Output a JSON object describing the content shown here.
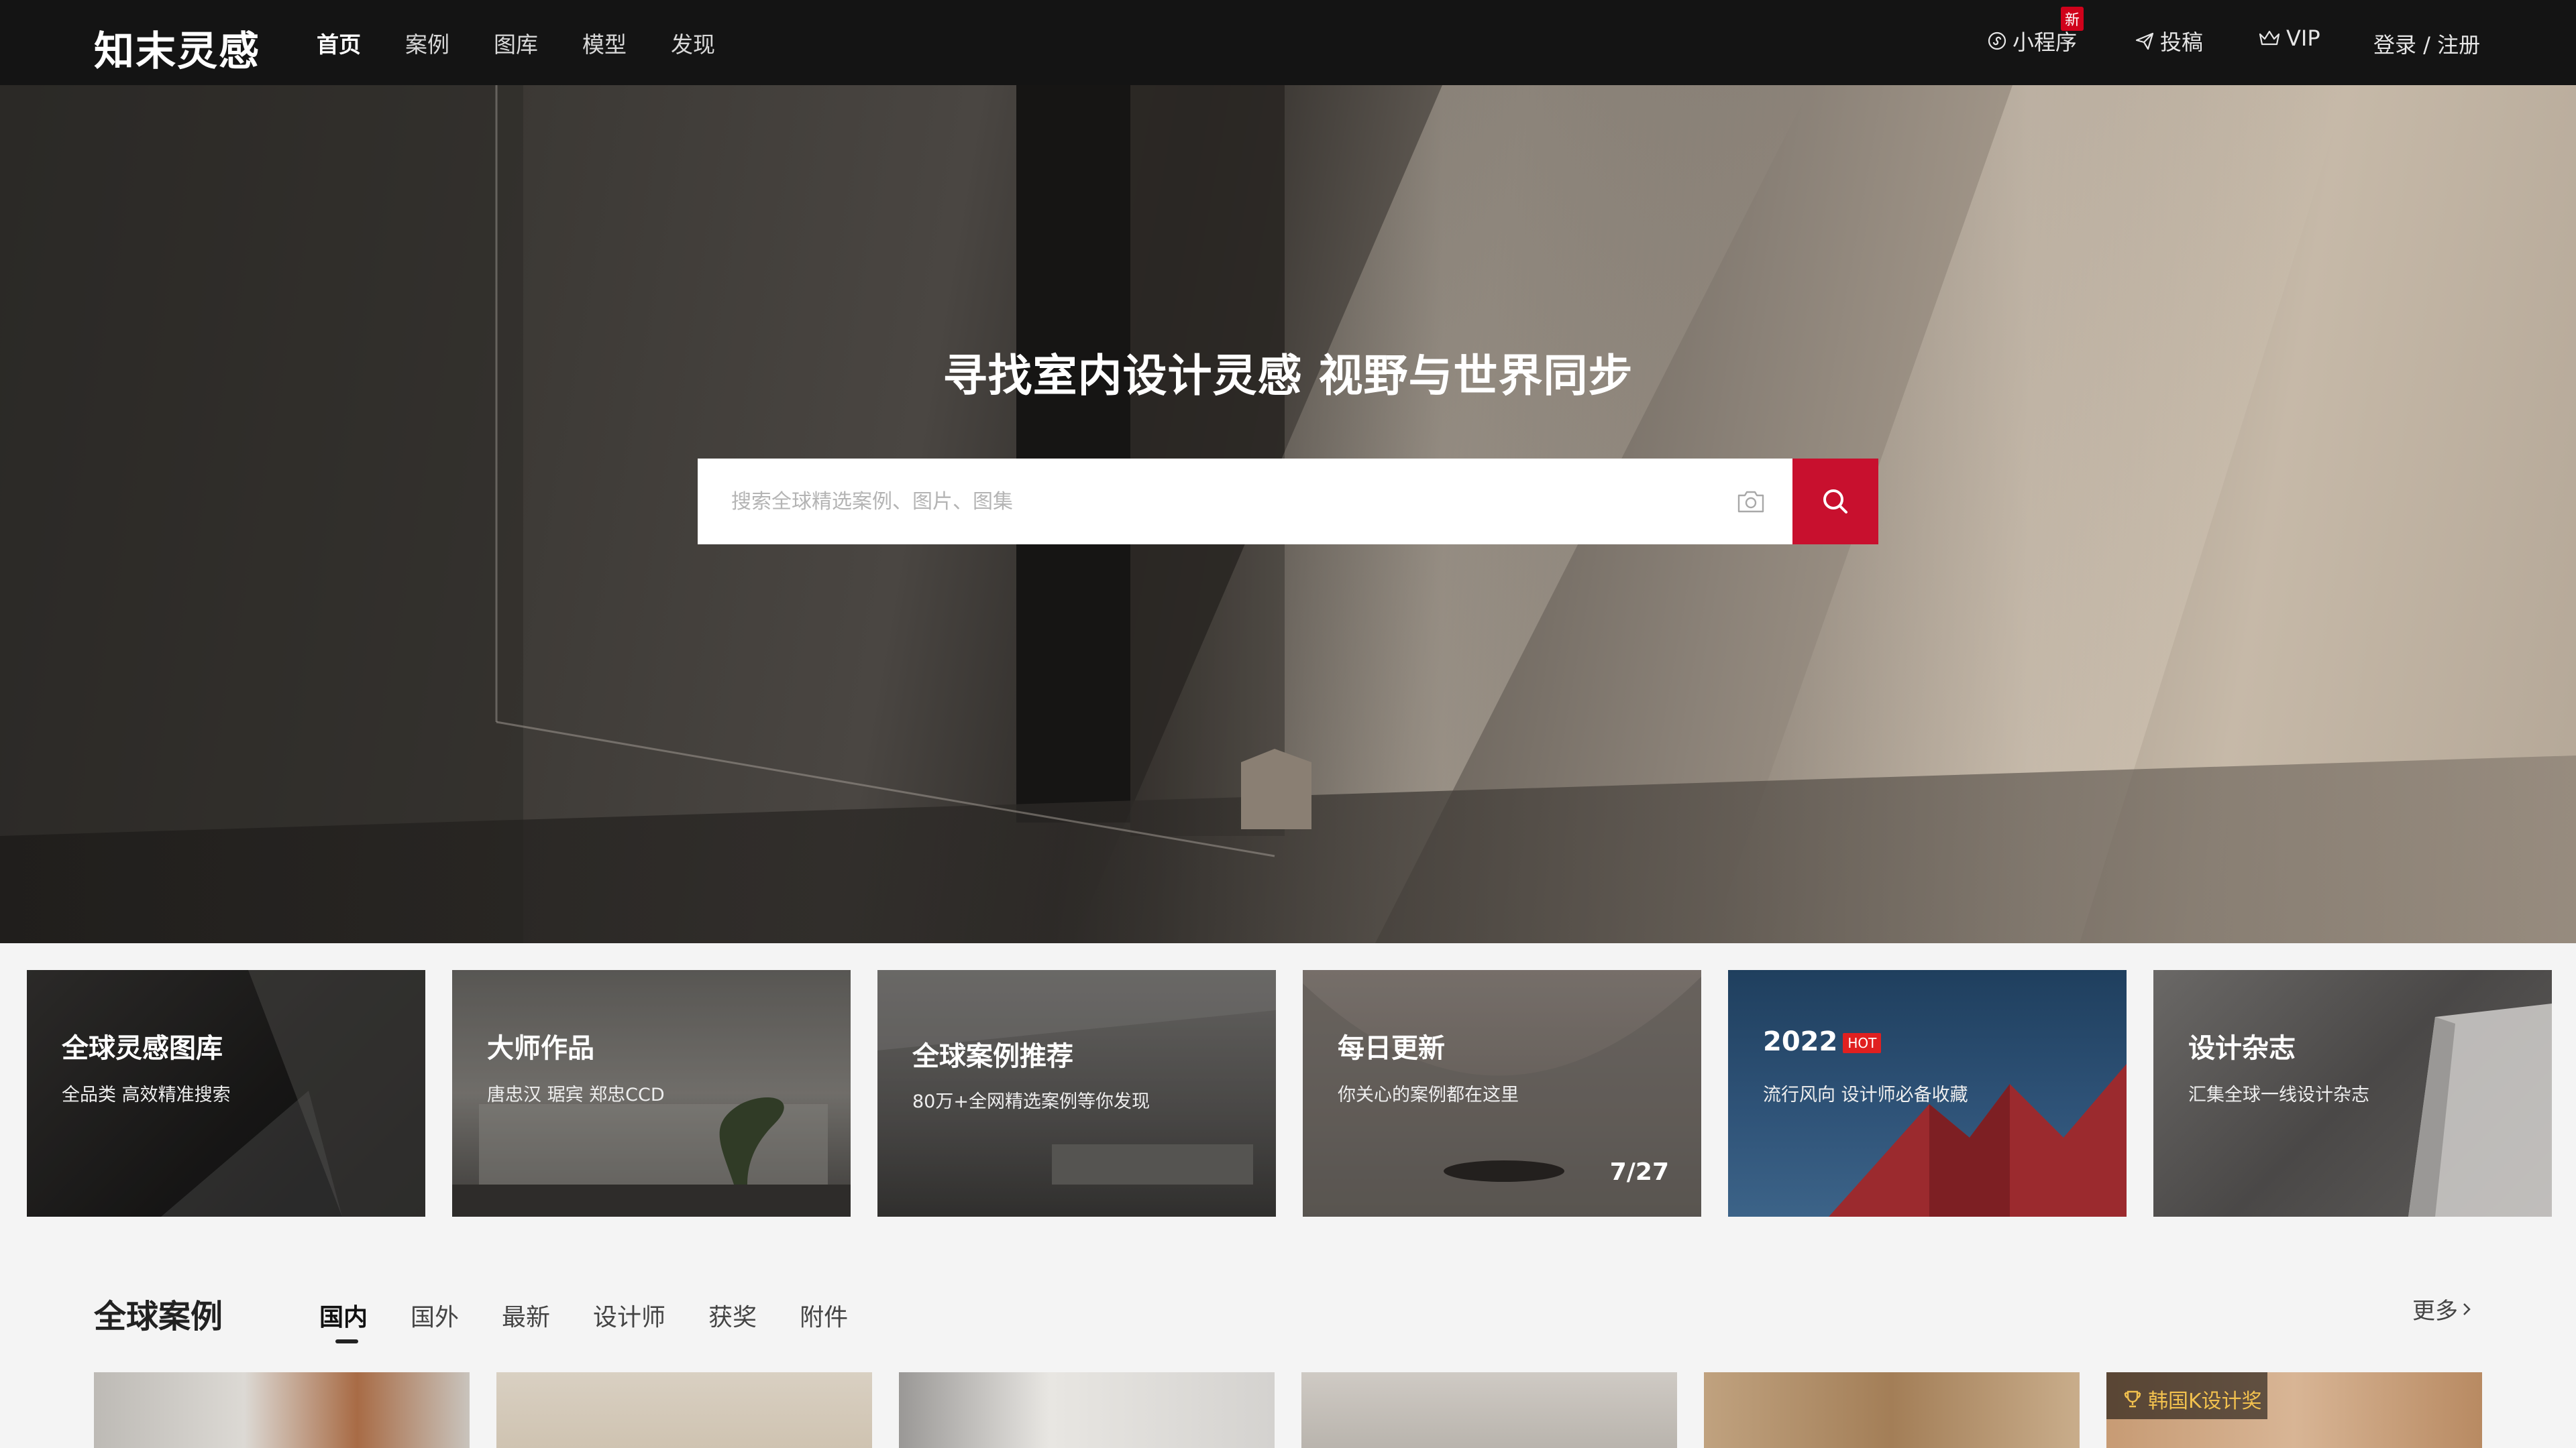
{
  "header": {
    "logo": "知末灵感",
    "nav": [
      {
        "label": "首页",
        "active": true
      },
      {
        "label": "案例",
        "active": false
      },
      {
        "label": "图库",
        "active": false
      },
      {
        "label": "模型",
        "active": false
      },
      {
        "label": "发现",
        "active": false
      }
    ],
    "mini_program": "小程序",
    "new_badge": "新",
    "submit": "投稿",
    "vip": "VIP",
    "login": "登录 / 注册"
  },
  "hero": {
    "title": "寻找室内设计灵感 视野与世界同步",
    "search_placeholder": "搜索全球精选案例、图片、图集",
    "icons": {
      "camera": "camera-icon",
      "search": "search-icon"
    },
    "accent_color": "#c8102e"
  },
  "cards": [
    {
      "title": "全球灵感图库",
      "subtitle": "全品类  高效精准搜索"
    },
    {
      "title": "大师作品",
      "subtitle": "唐忠汉   琚宾   郑忠CCD"
    },
    {
      "title": "全球案例推荐",
      "subtitle": "80万+全网精选案例等你发现"
    },
    {
      "title": "每日更新",
      "subtitle": "你关心的案例都在这里",
      "date": "7/27"
    },
    {
      "title": "2022",
      "badge": "HOT",
      "subtitle": "流行风向   设计师必备收藏"
    },
    {
      "title": "设计杂志",
      "subtitle": "汇集全球一线设计杂志"
    }
  ],
  "section": {
    "title": "全球案例",
    "tabs": [
      {
        "label": "国内",
        "active": true
      },
      {
        "label": "国外",
        "active": false
      },
      {
        "label": "最新",
        "active": false
      },
      {
        "label": "设计师",
        "active": false
      },
      {
        "label": "获奖",
        "active": false
      },
      {
        "label": "附件",
        "active": false
      }
    ],
    "more": "更多"
  },
  "thumbnails": {
    "award_label": "韩国K设计奖"
  }
}
